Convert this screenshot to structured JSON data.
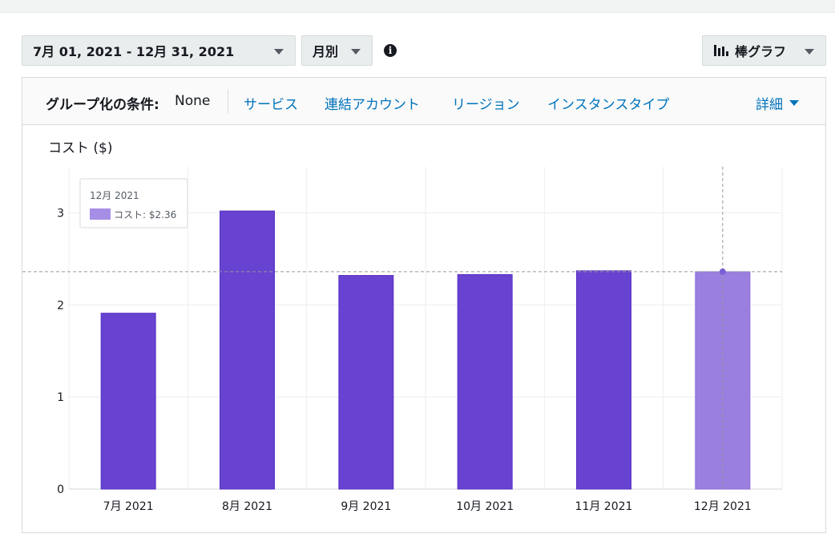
{
  "toolbar": {
    "date_range": "7月 01, 2021 - 12月 31, 2021",
    "granularity": "月別",
    "chart_type": "棒グラフ"
  },
  "group_by": {
    "label": "グループ化の条件:",
    "value": "None",
    "links": {
      "service": "サービス",
      "linked_account": "連結アカウント",
      "region": "リージョン",
      "instance_type": "インスタンスタイプ",
      "more": "詳細"
    }
  },
  "tooltip": {
    "title": "12月 2021",
    "text": "コスト: $2.36",
    "swatch_color": "#a68ee6"
  },
  "colors": {
    "bar": "#6842d0",
    "bar_highlight": "#9a7fe0",
    "link": "#0073bb"
  },
  "chart_data": {
    "type": "bar",
    "ylabel": "コスト ($)",
    "categories": [
      "7月 2021",
      "8月 2021",
      "9月 2021",
      "10月 2021",
      "11月 2021",
      "12月 2021"
    ],
    "values": [
      1.91,
      3.02,
      2.32,
      2.33,
      2.37,
      2.36
    ],
    "ylim": [
      0,
      3.5
    ],
    "yticks": [
      0,
      1,
      2,
      3
    ],
    "grid": true,
    "highlighted_index": 5
  }
}
